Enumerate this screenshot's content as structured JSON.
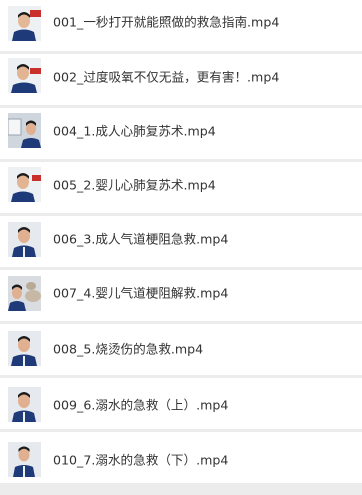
{
  "files": [
    {
      "name": "001_一秒打开就能照做的救急指南.mp4",
      "thumbnail": "video-thumbnail-instructor",
      "thumb_variant": "banner"
    },
    {
      "name": "002_过度吸氧不仅无益，更有害！.mp4",
      "thumbnail": "video-thumbnail-instructor",
      "thumb_variant": "banner"
    },
    {
      "name": "004_1.成人心肺复苏术.mp4",
      "thumbnail": "video-thumbnail-instructor",
      "thumb_variant": "screen"
    },
    {
      "name": "005_2.婴儿心肺复苏术.mp4",
      "thumbnail": "video-thumbnail-instructor",
      "thumb_variant": "banner"
    },
    {
      "name": "006_3.成人气道梗阻急救.mp4",
      "thumbnail": "video-thumbnail-instructor",
      "thumb_variant": "plain"
    },
    {
      "name": "007_4.婴儿气道梗阻解救.mp4",
      "thumbnail": "video-thumbnail-instructor",
      "thumb_variant": "demo"
    },
    {
      "name": "008_5.烧烫伤的急救.mp4",
      "thumbnail": "video-thumbnail-instructor",
      "thumb_variant": "plain"
    },
    {
      "name": "009_6.溺水的急救（上）.mp4",
      "thumbnail": "video-thumbnail-instructor",
      "thumb_variant": "plain"
    },
    {
      "name": "010_7.溺水的急救（下）.mp4",
      "thumbnail": "video-thumbnail-instructor",
      "thumb_variant": "plain"
    }
  ],
  "colors": {
    "background": "#ececec",
    "row": "#ffffff",
    "text": "#333333",
    "shirt": "#1f3a78",
    "banner": "#c9302c"
  }
}
